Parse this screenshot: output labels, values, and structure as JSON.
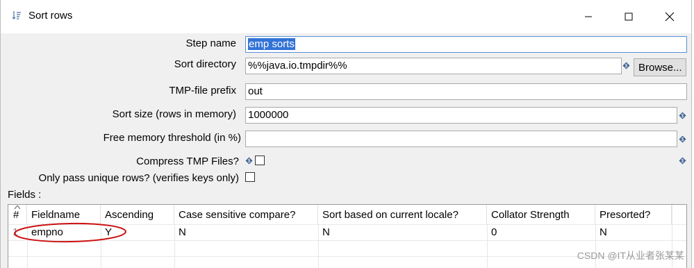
{
  "window": {
    "title": "Sort rows"
  },
  "form": {
    "step_name_label": "Step name",
    "step_name_value": "emp sorts",
    "sort_directory_label": "Sort directory",
    "sort_directory_value": "%%java.io.tmpdir%%",
    "browse_label": "Browse...",
    "tmp_prefix_label": "TMP-file prefix",
    "tmp_prefix_value": "out",
    "sort_size_label": "Sort size (rows in memory)",
    "sort_size_value": "1000000",
    "free_memory_label": "Free memory threshold (in %)",
    "free_memory_value": "",
    "compress_label": "Compress TMP Files?",
    "compress_checked": false,
    "unique_label": "Only pass unique rows? (verifies keys only)",
    "unique_checked": false
  },
  "fields": {
    "section_label": "Fields :",
    "columns": [
      "#",
      "Fieldname",
      "Ascending",
      "Case sensitive compare?",
      "Sort based on current locale?",
      "Collator Strength",
      "Presorted?"
    ],
    "rows": [
      {
        "num": "1",
        "fieldname": "empno",
        "ascending": "Y",
        "case_sensitive": "N",
        "locale": "N",
        "collator": "0",
        "presorted": "N"
      }
    ]
  },
  "watermark": "CSDN @IT从业者张某某",
  "colors": {
    "selection": "#3273d6",
    "annotation": "#cc1111",
    "window_bg": "#f0f0f0"
  }
}
